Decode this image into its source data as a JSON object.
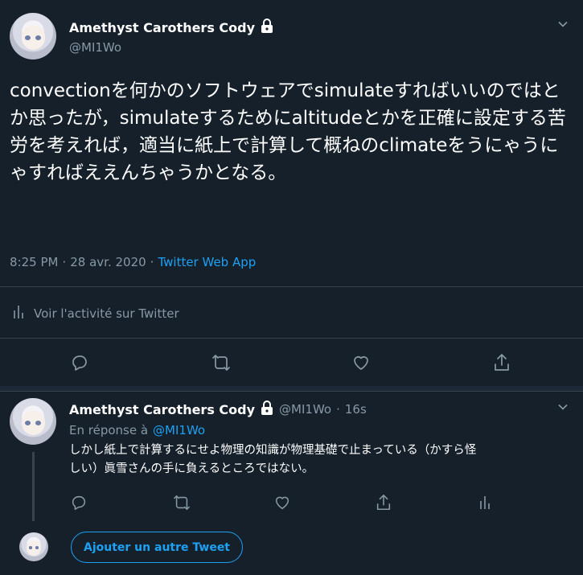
{
  "main_tweet": {
    "author_name": "Amethyst Carothers Cody",
    "handle": "@MI1Wo",
    "text": "convectionを何かのソフトウェアでsimulateすればいいのではとか思ったが，simulateするためにaltitudeとかを正確に設定する苦労を考えれば，適当に紙上で計算して概ねのclimateをうにゃうにゃすればええんちゃうかとなる。",
    "time": "8:25 PM",
    "date": "28 avr. 2020",
    "separator": "·",
    "source": "Twitter Web App",
    "activity_label": "Voir l'activité sur Twitter",
    "icons": [
      "reply-icon",
      "retweet-icon",
      "like-icon",
      "share-icon"
    ]
  },
  "reply_tweet": {
    "author_name": "Amethyst Carothers Cody",
    "handle": "@MI1Wo",
    "time_sep": "·",
    "time": "16s",
    "reply_prefix": "En réponse à",
    "reply_to": "@MI1Wo",
    "text": "しかし紙上で計算するにせよ物理の知識が物理基礎で止まっている（かすら怪しい）眞雪さんの手に負えるところではない。",
    "icons": [
      "reply-icon",
      "retweet-icon",
      "like-icon",
      "share-icon",
      "analytics-icon"
    ]
  },
  "compose": {
    "button_label": "Ajouter un autre Tweet"
  },
  "colors": {
    "background": "#15202b",
    "accent": "#1da1f2",
    "muted": "#8899a6",
    "divider": "#38444d"
  }
}
